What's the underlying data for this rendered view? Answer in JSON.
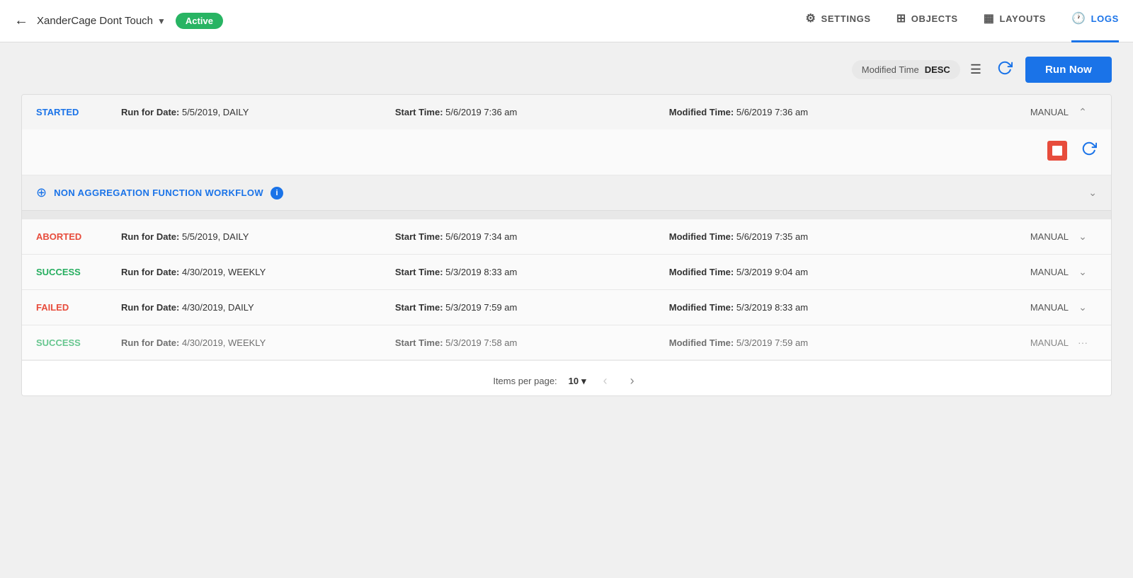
{
  "nav": {
    "back_label": "←",
    "title": "XanderCage Dont Touch",
    "dropdown_arrow": "▼",
    "active_badge": "Active",
    "links": [
      {
        "id": "settings",
        "label": "SETTINGS",
        "icon": "⚙"
      },
      {
        "id": "objects",
        "label": "OBJECTS",
        "icon": "⊞"
      },
      {
        "id": "layouts",
        "label": "LAYOUTS",
        "icon": "▦"
      },
      {
        "id": "logs",
        "label": "LOGS",
        "icon": "🕐",
        "active": true
      }
    ]
  },
  "toolbar": {
    "sort_field": "Modified Time",
    "sort_dir": "DESC",
    "run_now_label": "Run Now"
  },
  "logs": [
    {
      "status": "STARTED",
      "status_class": "started",
      "run_for_date": "5/5/2019, DAILY",
      "start_time": "5/6/2019 7:36 am",
      "modified_time": "5/6/2019 7:36 am",
      "trigger": "MANUAL",
      "expanded": true
    },
    {
      "status": "ABORTED",
      "status_class": "aborted",
      "run_for_date": "5/5/2019, DAILY",
      "start_time": "5/6/2019 7:34 am",
      "modified_time": "5/6/2019 7:35 am",
      "trigger": "MANUAL",
      "expanded": false
    },
    {
      "status": "SUCCESS",
      "status_class": "success",
      "run_for_date": "4/30/2019, WEEKLY",
      "start_time": "5/3/2019 8:33 am",
      "modified_time": "5/3/2019 9:04 am",
      "trigger": "MANUAL",
      "expanded": false
    },
    {
      "status": "FAILED",
      "status_class": "failed",
      "run_for_date": "4/30/2019, DAILY",
      "start_time": "5/3/2019 7:59 am",
      "modified_time": "5/3/2019 8:33 am",
      "trigger": "MANUAL",
      "expanded": false
    },
    {
      "status": "SUCCESS",
      "status_class": "success",
      "run_for_date": "4/30/2019, WEEKLY",
      "start_time": "5/3/2019 7:58 am",
      "modified_time": "5/3/2019 7:59 am",
      "trigger": "MANUAL",
      "expanded": false,
      "partial": true
    }
  ],
  "workflow": {
    "label": "NON AGGREGATION FUNCTION WORKFLOW"
  },
  "labels": {
    "run_for_date": "Run for Date:",
    "start_time": "Start Time:",
    "modified_time": "Modified Time:",
    "items_per_page": "Items per page:",
    "items_count": "10"
  }
}
